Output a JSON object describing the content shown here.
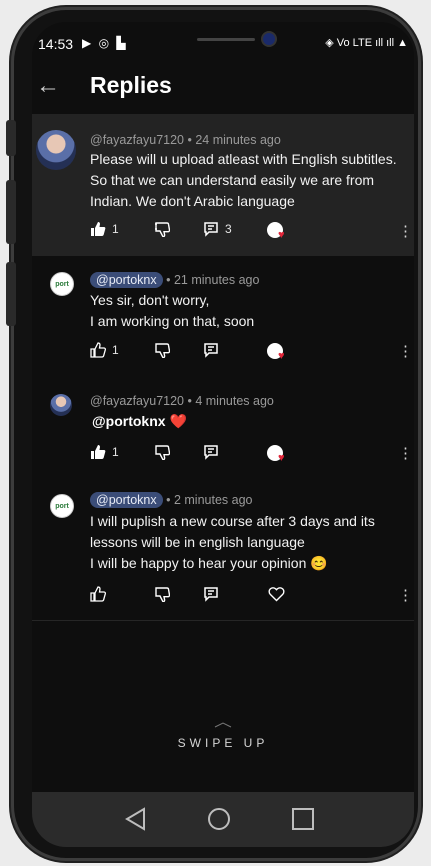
{
  "status_bar": {
    "time": "14:53",
    "left_icons": "▶ ◎ ▙",
    "right_icons": "◈ Vo LTE ıll ıll ▲"
  },
  "header": {
    "title": "Replies",
    "back_icon": "arrow-left-icon"
  },
  "comments": [
    {
      "author": "@fayazfayu7120",
      "time": "• 24 minutes ago",
      "lines": [
        "Please will  u upload  atleast with English subtitles.",
        "So that we can understand  easily we are from",
        "Indian. We don't Arabic language"
      ],
      "likes": "1",
      "replies": "3"
    },
    {
      "author": "@portoknx",
      "time": "• 21 minutes ago",
      "lines": [
        "Yes sir, don't worry,",
        "I am working on that, soon"
      ],
      "likes": "1"
    },
    {
      "author": "@fayazfayu7120",
      "time": "• 4 minutes ago",
      "mention": "@portoknx",
      "emoji": "❤️",
      "likes": "1"
    },
    {
      "author": "@portoknx",
      "time": "• 2 minutes ago",
      "lines": [
        "I will puplish a new course after 3 days and its",
        "lessons will be  in english language",
        "I will be happy to hear your opinion 😊"
      ]
    }
  ],
  "swipe_hint": "SWIPE UP",
  "avatar_badge": "port",
  "colors": {
    "background": "#0e0e0e",
    "highlight": "#232323",
    "mention_pill": "#3b4d78",
    "heart": "#e0263a"
  }
}
